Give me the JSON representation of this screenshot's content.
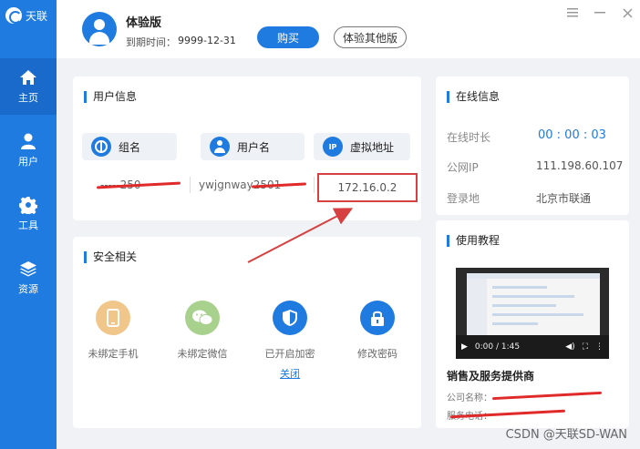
{
  "app": {
    "logo_text": "天联"
  },
  "nav": [
    {
      "label": "主页",
      "icon": "home-icon",
      "active": true
    },
    {
      "label": "用户",
      "icon": "user-icon",
      "active": false
    },
    {
      "label": "工具",
      "icon": "gear-icon",
      "active": false
    },
    {
      "label": "资源",
      "icon": "layers-icon",
      "active": false
    }
  ],
  "header": {
    "edition": "体验版",
    "expire_label": "到期时间：",
    "expire_value": "9999-12-31",
    "buy_label": "购买",
    "other_label": "体验其他版"
  },
  "user_info": {
    "title": "用户信息",
    "group_label": "组名",
    "username_label": "用户名",
    "vip_label": "虚拟地址",
    "group_value": "-----250",
    "username_value": "ywjgnway2501-",
    "vip_value": "172.16.0.2"
  },
  "security": {
    "title": "安全相关",
    "items": [
      {
        "label": "未绑定手机",
        "icon": "phone-icon",
        "color": "#f0c68a"
      },
      {
        "label": "未绑定微信",
        "icon": "wechat-icon",
        "color": "#a9d18e"
      },
      {
        "label": "已开启加密",
        "icon": "shield-icon",
        "color": "#1f7be0",
        "link": "关闭"
      },
      {
        "label": "修改密码",
        "icon": "lock-icon",
        "color": "#1f7be0"
      }
    ]
  },
  "online": {
    "title": "在线信息",
    "duration_label": "在线时长",
    "duration_value": "00 : 00 : 03",
    "public_ip_label": "公网IP",
    "public_ip_value": "111.198.60.107",
    "location_label": "登录地",
    "location_value": "北京市联通"
  },
  "tutorial": {
    "title": "使用教程",
    "time": "0:00 / 1:45",
    "vendor_title": "销售及服务提供商",
    "company_label": "公司名称：",
    "phone_label": "服务电话："
  },
  "watermark": "CSDN @天联SD-WAN"
}
